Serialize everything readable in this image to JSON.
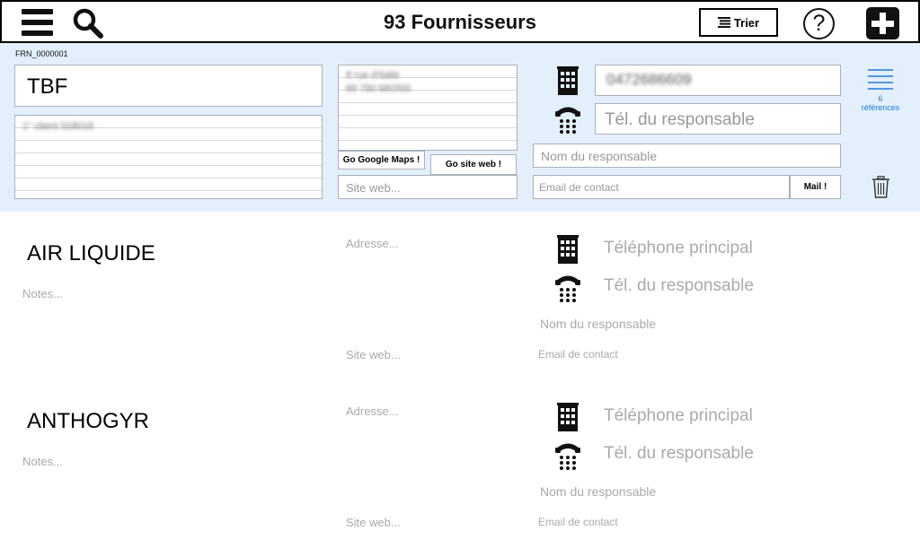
{
  "header": {
    "title": "93 Fournisseurs",
    "sort_label": "Trier",
    "help_label": "?"
  },
  "selected": {
    "code": "FRN_0000001",
    "name": "TBF",
    "notes": "1° client 318018",
    "address": "8 rue d'Italie\n69 780 MIONS",
    "google_maps_label": "Go Google Maps !",
    "go_site_label": "Go site web !",
    "site_placeholder": "Site web...",
    "phone": "0472686609",
    "resp_phone_placeholder": "Tél. du responsable",
    "resp_name_placeholder": "Nom du responsable",
    "email_placeholder": "Email de contact",
    "mail_label": "Mail !",
    "references_count": "6",
    "references_label": "références"
  },
  "rows": [
    {
      "name": "AIR LIQUIDE",
      "notes": "Notes...",
      "address": "Adresse...",
      "site": "Site web...",
      "phone": "Téléphone principal",
      "resp_phone": "Tél. du responsable",
      "resp_name": "Nom du responsable",
      "email": "Email de contact"
    },
    {
      "name": "ANTHOGYR",
      "notes": "Notes...",
      "address": "Adresse...",
      "site": "Site web...",
      "phone": "Téléphone principal",
      "resp_phone": "Tél. du responsable",
      "resp_name": "Nom du responsable",
      "email": "Email de contact"
    }
  ],
  "icons": {
    "menu": "hamburger-icon",
    "search": "search-icon",
    "sort": "sort-lines-icon",
    "help": "help-icon",
    "add": "plus-icon",
    "building": "building-icon",
    "phone": "telephone-icon",
    "references": "list-icon",
    "delete": "trash-icon"
  },
  "colors": {
    "selected_bg": "#e3f0fc",
    "accent": "#1f7ad8",
    "placeholder": "#aaaaaa"
  }
}
